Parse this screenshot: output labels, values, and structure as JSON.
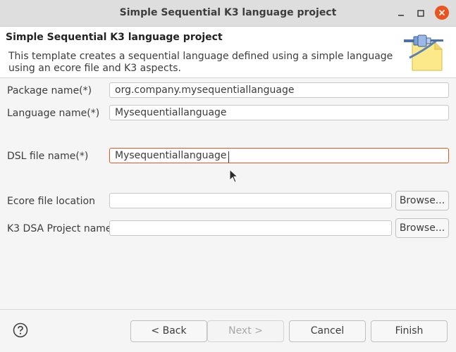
{
  "window": {
    "title": "Simple Sequential K3 language project",
    "controls": [
      "minimize-icon",
      "maximize-icon",
      "close-icon"
    ]
  },
  "header": {
    "title": "Simple Sequential K3 language project",
    "description": "This template creates a sequential language defined using a simple language using an ecore file and K3 aspects.",
    "icon": "wizard-plugin-icon"
  },
  "form": {
    "package_name": {
      "label": "Package name(*)",
      "value": "org.company.mysequentiallanguage"
    },
    "language_name": {
      "label": "Language name(*)",
      "value": "Mysequentiallanguage"
    },
    "dsl_file_name": {
      "label": "DSL file name(*)",
      "value": "Mysequentiallanguage"
    },
    "ecore_file_location": {
      "label": "Ecore file location",
      "value": "",
      "browse_label": "Browse..."
    },
    "k3_dsa_project_name": {
      "label": "K3 DSA Project name",
      "value": "",
      "browse_label": "Browse..."
    }
  },
  "footer": {
    "help_icon": "help-icon",
    "back_label": "< Back",
    "next_label": "Next >",
    "cancel_label": "Cancel",
    "finish_label": "Finish"
  },
  "colors": {
    "accent": "#e95420",
    "titlebar": "#dedede",
    "panel": "#f5f5f5"
  }
}
